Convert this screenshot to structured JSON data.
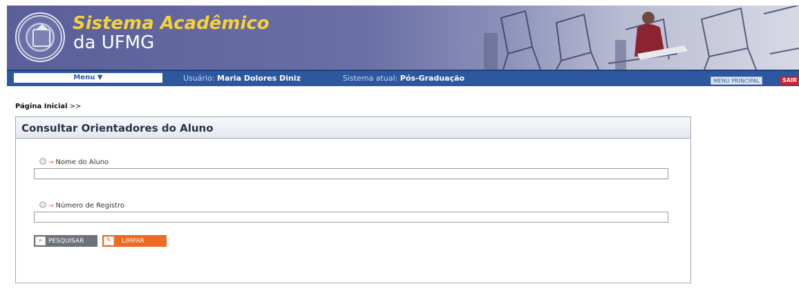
{
  "header": {
    "title": "Sistema Acadêmico",
    "subtitle": "da UFMG"
  },
  "navbar": {
    "menu_label": "Menu ▼",
    "user_label": "Usuário:",
    "user_name": "Maria Dolores Diniz",
    "system_label": "Sistema atual:",
    "system_name": "Pós-Graduação",
    "main_menu_label": "MENU PRINCIPAL",
    "exit_label": "SAIR"
  },
  "breadcrumb": {
    "home_label": "Página Inicial",
    "separator": ">>"
  },
  "panel": {
    "title": "Consultar Orientadores do Aluno",
    "fields": [
      {
        "label": "Nome do Aluno",
        "value": "",
        "placeholder": ""
      },
      {
        "label": "Número de Registro",
        "value": "",
        "placeholder": ""
      }
    ],
    "buttons": {
      "search_label": "PESQUISAR",
      "clear_label": "LIMPAR"
    }
  },
  "colors": {
    "banner": "#6a6fa6",
    "title_yellow": "#f6d23a",
    "navbar_blue": "#2d58a0",
    "clear_orange": "#ec6a24",
    "exit_red": "#d41f2a"
  }
}
